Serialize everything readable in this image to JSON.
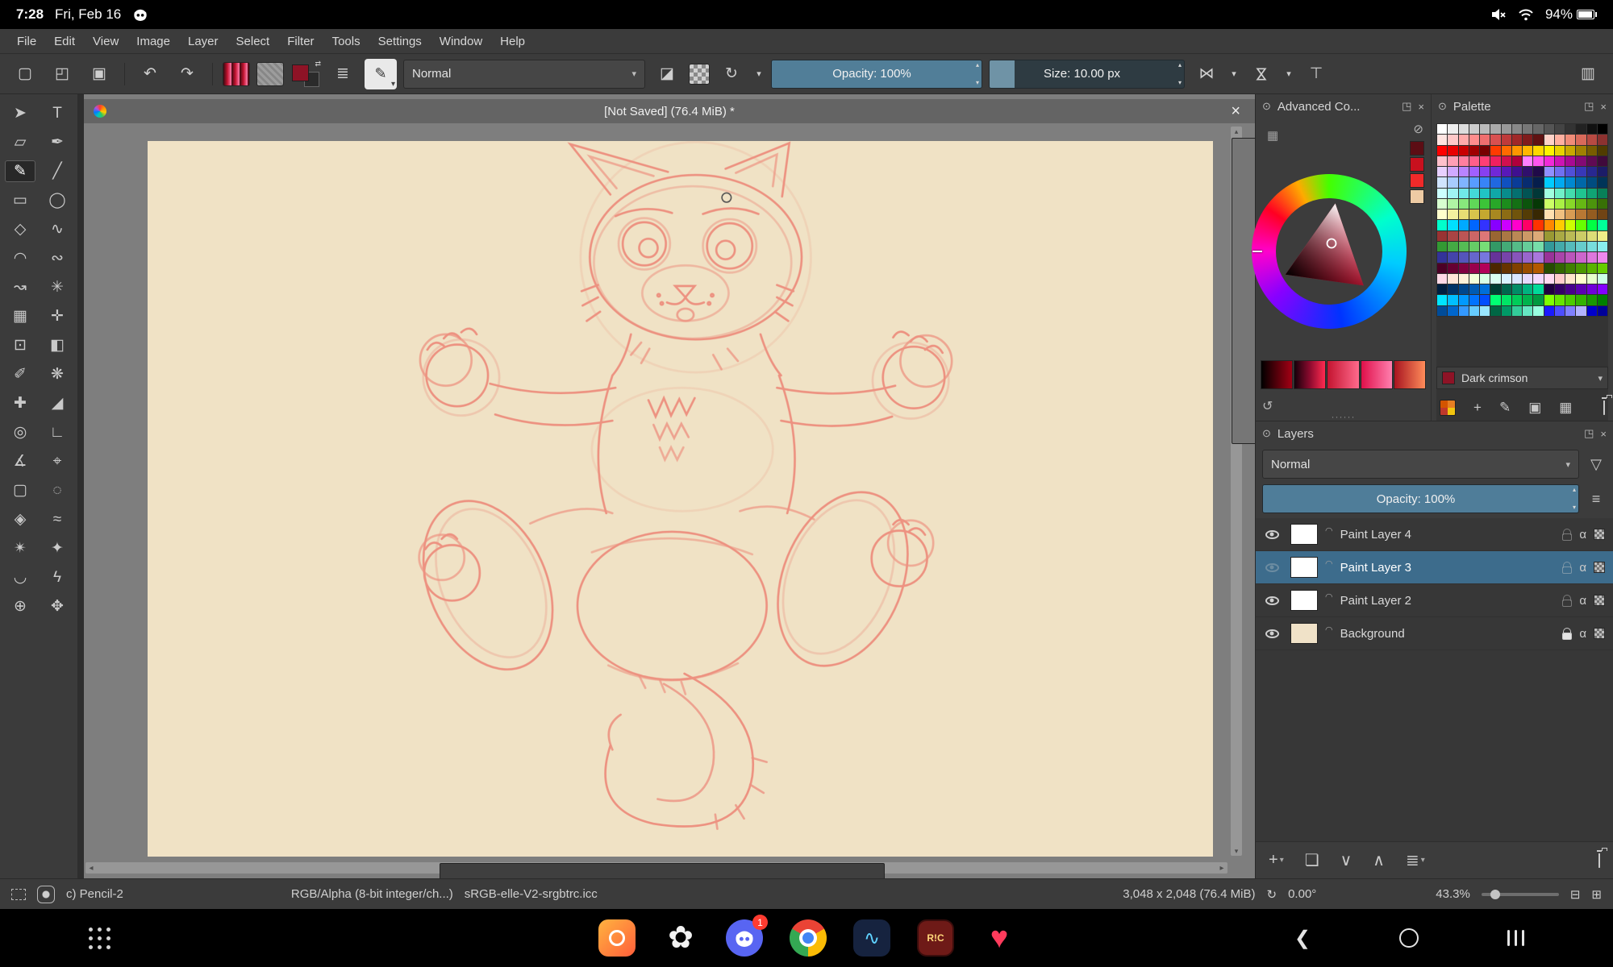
{
  "android": {
    "status": {
      "time": "7:28",
      "date": "Fri, Feb 16",
      "battery": "94%"
    },
    "nav": {
      "discord_badge": "1",
      "osrs_label": "R!C"
    }
  },
  "menu_bar": {
    "items": [
      "File",
      "Edit",
      "View",
      "Image",
      "Layer",
      "Select",
      "Filter",
      "Tools",
      "Settings",
      "Window",
      "Help"
    ]
  },
  "toolbar": {
    "blending_mode": "Normal",
    "opacity": "Opacity: 100%",
    "size": "Size: 10.00 px"
  },
  "document": {
    "title": "[Not Saved] (76.4 MiB) *"
  },
  "toolbox": {
    "tools": [
      {
        "id": "shape-select",
        "glyph": "➤"
      },
      {
        "id": "text",
        "glyph": "T"
      },
      {
        "id": "edit-shapes",
        "glyph": "▱"
      },
      {
        "id": "calligraphy",
        "glyph": "✒"
      },
      {
        "id": "freehand-brush",
        "glyph": "✎",
        "selected": true
      },
      {
        "id": "line",
        "glyph": "╱"
      },
      {
        "id": "rectangle",
        "glyph": "▭"
      },
      {
        "id": "ellipse",
        "glyph": "◯"
      },
      {
        "id": "polygon",
        "glyph": "◇"
      },
      {
        "id": "polyline",
        "glyph": "∿"
      },
      {
        "id": "bezier-curve",
        "glyph": "◠"
      },
      {
        "id": "freehand-path",
        "glyph": "∾"
      },
      {
        "id": "dynamic-brush",
        "glyph": "↝"
      },
      {
        "id": "multibrush",
        "glyph": "✳"
      },
      {
        "id": "transform",
        "glyph": "▦"
      },
      {
        "id": "move",
        "glyph": "✛"
      },
      {
        "id": "crop",
        "glyph": "⊡"
      },
      {
        "id": "gradient",
        "glyph": "◧"
      },
      {
        "id": "color-sampler",
        "glyph": "✐"
      },
      {
        "id": "pattern-edit",
        "glyph": "❋"
      },
      {
        "id": "smart-patch",
        "glyph": "✚"
      },
      {
        "id": "fill",
        "glyph": "◢"
      },
      {
        "id": "enclose-fill",
        "glyph": "◎"
      },
      {
        "id": "assistants",
        "glyph": "∟"
      },
      {
        "id": "measure",
        "glyph": "∡"
      },
      {
        "id": "reference-images",
        "glyph": "⌖"
      },
      {
        "id": "rect-select",
        "glyph": "▢"
      },
      {
        "id": "ellipse-select",
        "glyph": "◌"
      },
      {
        "id": "polygon-select",
        "glyph": "◈"
      },
      {
        "id": "freehand-select",
        "glyph": "≈"
      },
      {
        "id": "similar-select",
        "glyph": "✴"
      },
      {
        "id": "contiguous-select",
        "glyph": "✦"
      },
      {
        "id": "bezier-select",
        "glyph": "◡"
      },
      {
        "id": "magnetic-select",
        "glyph": "ϟ"
      },
      {
        "id": "zoom",
        "glyph": "⊕"
      },
      {
        "id": "pan",
        "glyph": "✥"
      }
    ]
  },
  "dockers": {
    "advanced_color": {
      "title": "Advanced Co...",
      "recent_colors": [
        "#5c0d14",
        "#c8101e",
        "#f02a2a",
        "#eecba4"
      ],
      "shade_strips": [
        "linear-gradient(90deg,#000000,#52000a,#a30014)",
        "linear-gradient(90deg,#14000a,#8c0a2e,#ff2a50)",
        "linear-gradient(90deg,#c41430,#ff6a8c)",
        "linear-gradient(90deg,#e0104a,#ff7fae)",
        "linear-gradient(90deg,#a81420,#ff8c5a)"
      ]
    },
    "palette": {
      "title": "Palette",
      "selected_color_name": "Dark crimson",
      "selected_color_hex": "#8e1326",
      "rows": [
        [
          "#ffffff",
          "#eeeeee",
          "#dddddd",
          "#cccccc",
          "#bbbbbb",
          "#aaaaaa",
          "#999999",
          "#888888",
          "#777777",
          "#666666",
          "#555555",
          "#444444",
          "#333333",
          "#222222",
          "#111111",
          "#000000"
        ],
        [
          "#ffe4e1",
          "#ffc8c8",
          "#ffaaaa",
          "#ff8c8c",
          "#f06e6e",
          "#d95050",
          "#bf3a3a",
          "#a02828",
          "#801c1c",
          "#601212",
          "#ffd2c8",
          "#ffb0a0",
          "#f08c78",
          "#d96a5a",
          "#b84a42",
          "#8c3230"
        ],
        [
          "#ff0000",
          "#e80000",
          "#c80000",
          "#a00000",
          "#780000",
          "#ff3b00",
          "#ff6a00",
          "#ff9500",
          "#ffb700",
          "#ffd800",
          "#fff200",
          "#e8d200",
          "#c8a800",
          "#a08000",
          "#785c00",
          "#503c00"
        ],
        [
          "#ffc0cb",
          "#ff9fb5",
          "#ff7f9f",
          "#ff5f8a",
          "#ff3f75",
          "#f02060",
          "#d0104e",
          "#b0003c",
          "#ff80ff",
          "#ff55ee",
          "#f02ad8",
          "#cc14b4",
          "#a80a94",
          "#840a74",
          "#600a54",
          "#400a3c"
        ],
        [
          "#e8d0ff",
          "#d0aaff",
          "#b884ff",
          "#a060ff",
          "#8840f0",
          "#7028d8",
          "#5818b8",
          "#401090",
          "#30106c",
          "#200a48",
          "#9090ff",
          "#7070f0",
          "#5050d8",
          "#3838b8",
          "#282890",
          "#1c1c68"
        ],
        [
          "#d0e4ff",
          "#a8ccff",
          "#80b4ff",
          "#589cff",
          "#3884f8",
          "#2068e0",
          "#1050c0",
          "#0a3c98",
          "#082c70",
          "#061e4c",
          "#00ccff",
          "#00aaf0",
          "#0088d0",
          "#0068a8",
          "#004c80",
          "#003458"
        ],
        [
          "#ccffff",
          "#a0f4f4",
          "#70e8e8",
          "#44d8d8",
          "#20c4c4",
          "#10a8a8",
          "#088c8c",
          "#047070",
          "#025454",
          "#013838",
          "#a0ffe0",
          "#70f0c8",
          "#44dcac",
          "#20c490",
          "#10a474",
          "#088058"
        ],
        [
          "#d8ffd0",
          "#b0f4a4",
          "#88e87c",
          "#60d858",
          "#3cc438",
          "#28a828",
          "#1c8c1c",
          "#147014",
          "#0c540c",
          "#063806",
          "#ccff66",
          "#aaf044",
          "#88d828",
          "#66b814",
          "#4c940c",
          "#387006"
        ],
        [
          "#ffffcc",
          "#f4f0a0",
          "#e8dc74",
          "#d8c44c",
          "#c4a830",
          "#a88820",
          "#8c6c14",
          "#70540c",
          "#543c06",
          "#382803",
          "#ffe0b0",
          "#f0c080",
          "#d89c54",
          "#b87834",
          "#945c20",
          "#704414"
        ],
        [
          "#00ffcc",
          "#00e0ff",
          "#00aaff",
          "#0066ff",
          "#3333ff",
          "#8800ff",
          "#cc00ff",
          "#ff00cc",
          "#ff0066",
          "#ff3300",
          "#ff8800",
          "#ffcc00",
          "#ccff00",
          "#66ff00",
          "#00ff44",
          "#00ff99"
        ],
        [
          "#993333",
          "#aa4444",
          "#bb5555",
          "#cc6666",
          "#dd7777",
          "#996633",
          "#aa7744",
          "#bb8855",
          "#cc9966",
          "#ddaa77",
          "#999933",
          "#aaaa44",
          "#bbbb55",
          "#cccc66",
          "#dddd77",
          "#eeee88"
        ],
        [
          "#339933",
          "#44aa44",
          "#55bb55",
          "#66cc66",
          "#77dd77",
          "#339966",
          "#44aa77",
          "#55bb88",
          "#66cc99",
          "#77ddaa",
          "#339999",
          "#44aaaa",
          "#55bbbb",
          "#66cccc",
          "#77dddd",
          "#88eeee"
        ],
        [
          "#333399",
          "#4444aa",
          "#5555bb",
          "#6666cc",
          "#7777dd",
          "#663399",
          "#7744aa",
          "#8855bb",
          "#9966cc",
          "#aa77dd",
          "#993399",
          "#aa44aa",
          "#bb55bb",
          "#cc66cc",
          "#dd77dd",
          "#ee88ee"
        ],
        [
          "#4c0026",
          "#660033",
          "#800040",
          "#99004c",
          "#b30059",
          "#4c2600",
          "#663300",
          "#804000",
          "#994c00",
          "#b35900",
          "#264c00",
          "#336600",
          "#408000",
          "#4c9900",
          "#59b300",
          "#66cc00"
        ],
        [
          "#ffd9e6",
          "#ffe6d9",
          "#fff2d9",
          "#f2ffd9",
          "#d9ffe6",
          "#d9fff2",
          "#d9f2ff",
          "#d9e6ff",
          "#e6d9ff",
          "#f2d9ff",
          "#ffd9f2",
          "#ffcccc",
          "#ffe6cc",
          "#ffffcc",
          "#e6ffcc",
          "#ccffe6"
        ],
        [
          "#001f3f",
          "#003366",
          "#00478c",
          "#005bb3",
          "#006fd9",
          "#003f33",
          "#00664d",
          "#008c66",
          "#00b380",
          "#00d999",
          "#1f003f",
          "#330066",
          "#47008c",
          "#5b00b3",
          "#6f00d9",
          "#8300ff"
        ],
        [
          "#00e5ff",
          "#00bfff",
          "#0099ff",
          "#0073ff",
          "#004dff",
          "#00ff73",
          "#00e566",
          "#00cc59",
          "#00b34d",
          "#009940",
          "#7fff00",
          "#66e500",
          "#4ccc00",
          "#33b300",
          "#199900",
          "#008000"
        ],
        [
          "#004c99",
          "#0066cc",
          "#3399ff",
          "#66ccff",
          "#99e6ff",
          "#006644",
          "#009966",
          "#33cc99",
          "#66e6c2",
          "#99ffe0",
          "#1a1aff",
          "#4d4dff",
          "#8080ff",
          "#b3b3ff",
          "#0000cc",
          "#000099"
        ]
      ]
    },
    "layers": {
      "title": "Layers",
      "blending_mode": "Normal",
      "opacity": "Opacity: 100%",
      "items": [
        {
          "name": "Paint Layer 4",
          "visible": true,
          "selected": false,
          "locked": false,
          "thumb": "checker"
        },
        {
          "name": "Paint Layer 3",
          "visible": false,
          "selected": true,
          "locked": false,
          "thumb": "checker"
        },
        {
          "name": "Paint Layer 2",
          "visible": true,
          "selected": false,
          "locked": false,
          "thumb": "sketch"
        },
        {
          "name": "Background",
          "visible": true,
          "selected": false,
          "locked": true,
          "thumb": "#f0e2c8"
        }
      ]
    }
  },
  "statusbar": {
    "brush": "c) Pencil-2",
    "color_mode": "RGB/Alpha (8-bit integer/ch...)",
    "profile": "sRGB-elle-V2-srgbtrc.icc",
    "dimensions": "3,048 x 2,048 (76.4 MiB)",
    "rotation": "0.00°",
    "zoom": "43.3%"
  },
  "icons": {
    "new": "▢",
    "open": "◰",
    "save": "▣",
    "undo": "↶",
    "redo": "↷",
    "presets": "≣",
    "brush_editor": "✎",
    "dropdown": "▾",
    "eraser": "◪",
    "reload": "↻",
    "mirror": "⋈",
    "trim": "⊤",
    "workspace": "▥",
    "close": "×",
    "float": "◳",
    "docker_lock": "⊙",
    "filter": "▽",
    "menu": "≡",
    "alpha": "α",
    "add": "+",
    "duplicate": "❏",
    "down": "∨",
    "up": "∧",
    "properties": "≣",
    "sync": "↺",
    "grid": "▦",
    "edit": "✎",
    "save_palette": "▣",
    "no_color": "⊘",
    "scroll_up": "▴",
    "scroll_down": "▾",
    "scroll_left": "◂",
    "scroll_right": "▸",
    "zoom_out": "⊟",
    "zoom_in": "⊞",
    "spin_up": "▴",
    "spin_down": "▾",
    "handle": "······",
    "swap": "⇄",
    "layer_badge": "◠"
  },
  "colors": {
    "accent": "#4f7d99",
    "selected_layer": "#3d6c8c",
    "canvas": "#f0e2c5",
    "sketch_stroke": "#ec8a7a",
    "fg_color": "#8e1326"
  }
}
